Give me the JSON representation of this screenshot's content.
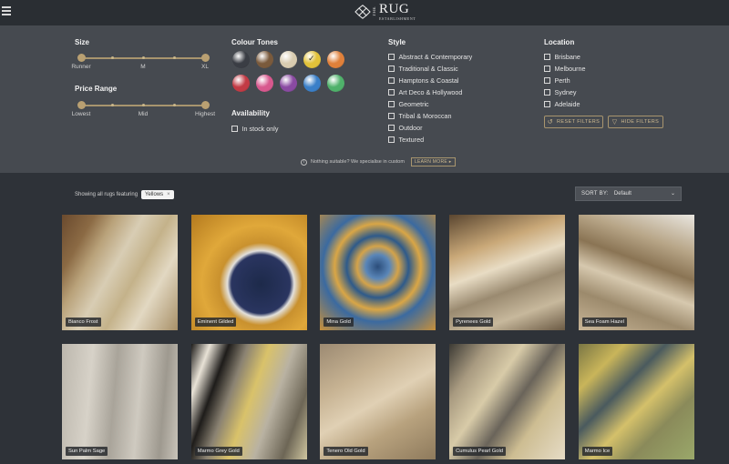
{
  "logo": {
    "the": "THE",
    "rug": "RUG",
    "est": "ESTABLISHMENT"
  },
  "filters": {
    "size": {
      "title": "Size",
      "labels": [
        "Runner",
        "M",
        "XL"
      ]
    },
    "price": {
      "title": "Price Range",
      "labels": [
        "Lowest",
        "Mid",
        "Highest"
      ]
    },
    "colour": {
      "title": "Colour Tones",
      "swatches": [
        {
          "name": "charcoal",
          "color": "#3a3d44",
          "selected": false
        },
        {
          "name": "brown",
          "color": "#7a5a3c",
          "selected": false
        },
        {
          "name": "cream",
          "color": "#d9ccb0",
          "selected": false
        },
        {
          "name": "yellow",
          "color": "#e2c23a",
          "selected": true
        },
        {
          "name": "orange",
          "color": "#e0803a",
          "selected": false
        },
        {
          "name": "red",
          "color": "#c23a44",
          "selected": false
        },
        {
          "name": "pink",
          "color": "#d8588e",
          "selected": false
        },
        {
          "name": "purple",
          "color": "#8a4aa2",
          "selected": false
        },
        {
          "name": "blue",
          "color": "#3a7fc8",
          "selected": false
        },
        {
          "name": "green",
          "color": "#4fb16a",
          "selected": false
        }
      ]
    },
    "availability": {
      "title": "Availability",
      "options": [
        "In stock only"
      ]
    },
    "style": {
      "title": "Style",
      "options": [
        "Abstract & Contemporary",
        "Traditional & Classic",
        "Hamptons & Coastal",
        "Art Deco & Hollywood",
        "Geometric",
        "Tribal & Moroccan",
        "Outdoor",
        "Textured"
      ]
    },
    "location": {
      "title": "Location",
      "options": [
        "Brisbane",
        "Melbourne",
        "Perth",
        "Sydney",
        "Adelaide"
      ]
    },
    "reset_label": "RESET FILTERS",
    "hide_label": "HIDE FILTERS",
    "suggest_text": "Nothing suitable? We specialise in custom",
    "learn_label": "LEARN MORE ▸"
  },
  "results": {
    "showing_text": "Showing all rugs featuring",
    "chip_label": "Yellows",
    "sort_label": "SORT BY:",
    "sort_value": "Default"
  },
  "products": [
    {
      "name": "Bianco Frost"
    },
    {
      "name": "Eminent Gilded"
    },
    {
      "name": "Mina Gold"
    },
    {
      "name": "Pyrenees Gold"
    },
    {
      "name": "Sea Foam Hazel"
    },
    {
      "name": "Sun Palm Sage"
    },
    {
      "name": "Marmo Grey Gold"
    },
    {
      "name": "Tenero Old Gold"
    },
    {
      "name": "Cumulus Pearl Gold"
    },
    {
      "name": "Marmo Ice"
    }
  ]
}
